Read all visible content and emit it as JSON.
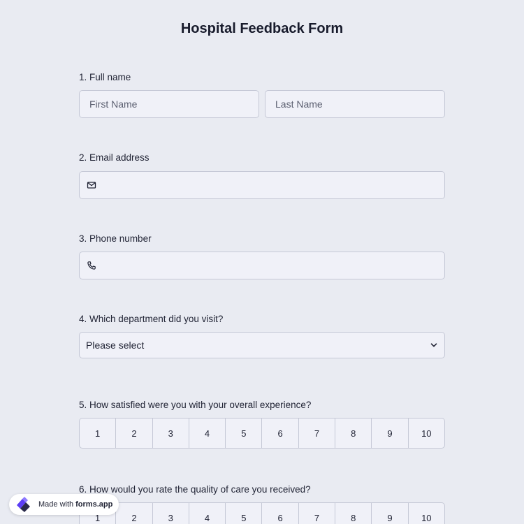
{
  "form": {
    "title": "Hospital Feedback Form"
  },
  "questions": {
    "q1": {
      "label": "1.  Full name",
      "first_placeholder": "First Name",
      "last_placeholder": "Last Name"
    },
    "q2": {
      "label": "2. Email address",
      "icon": "mail-icon"
    },
    "q3": {
      "label": "3. Phone number",
      "icon": "phone-icon"
    },
    "q4": {
      "label": "4. Which department did you visit?",
      "selected": "Please select",
      "icon": "chevron-down-icon"
    },
    "q5": {
      "label": "5. How satisfied were you with your overall experience?",
      "options": [
        "1",
        "2",
        "3",
        "4",
        "5",
        "6",
        "7",
        "8",
        "9",
        "10"
      ]
    },
    "q6": {
      "label": "6. How would you rate the quality of care you received?",
      "options": [
        "1",
        "2",
        "3",
        "4",
        "5",
        "6",
        "7",
        "8",
        "9",
        "10"
      ]
    }
  },
  "badge": {
    "made_with": "Made with",
    "brand": "forms.app",
    "logo_colors": [
      "#5b3df5",
      "#2a2a4a"
    ]
  }
}
